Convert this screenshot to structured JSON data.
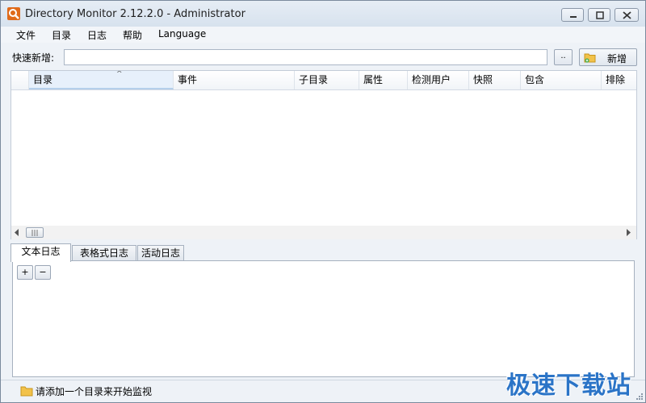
{
  "window": {
    "title": "Directory Monitor 2.12.2.0 - Administrator"
  },
  "menu": [
    "文件",
    "目录",
    "日志",
    "帮助",
    "Language"
  ],
  "toolbar": {
    "quick_add_label": "快速新增:",
    "quick_add_value": "",
    "browse_label": "..",
    "add_label": "新增"
  },
  "grid": {
    "columns": [
      "目录",
      "事件",
      "子目录",
      "属性",
      "检测用户",
      "快照",
      "包含",
      "排除"
    ],
    "sorted_column": "目录",
    "rows": []
  },
  "tabs": [
    "文本日志",
    "表格式日志",
    "活动日志"
  ],
  "log_panel": {
    "expand_label": "+",
    "collapse_label": "−"
  },
  "status": {
    "text": "请添加一个目录来开始监视"
  },
  "watermark": "极速下载站",
  "colors": {
    "accent": "#e06a1a",
    "watermark": "#2b74c7"
  }
}
